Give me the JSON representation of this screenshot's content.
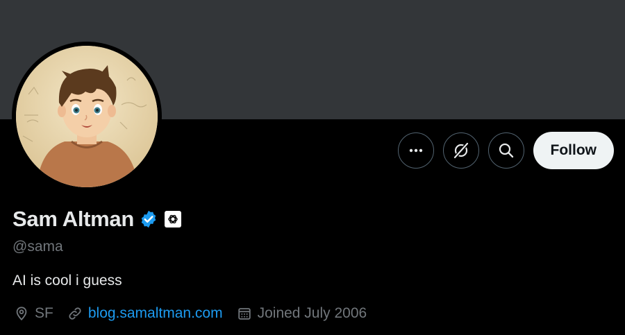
{
  "profile": {
    "display_name": "Sam Altman",
    "handle": "@sama",
    "bio": "AI is cool i guess",
    "location": "SF",
    "website": "blog.samaltman.com",
    "joined": "Joined July 2006",
    "verified_badge_icon": "verified-check-icon",
    "affiliate_badge_icon": "openai-logo-icon"
  },
  "actions": {
    "more_icon": "more-horizontal-icon",
    "grok_icon": "grok-icon",
    "search_icon": "search-icon",
    "follow_label": "Follow"
  },
  "colors": {
    "banner": "#333639",
    "background": "#000000",
    "primary_text": "#e7e9ea",
    "secondary_text": "#71767b",
    "link": "#1d9bf0",
    "verified": "#1d9bf0",
    "follow_button_bg": "#eff3f4"
  }
}
